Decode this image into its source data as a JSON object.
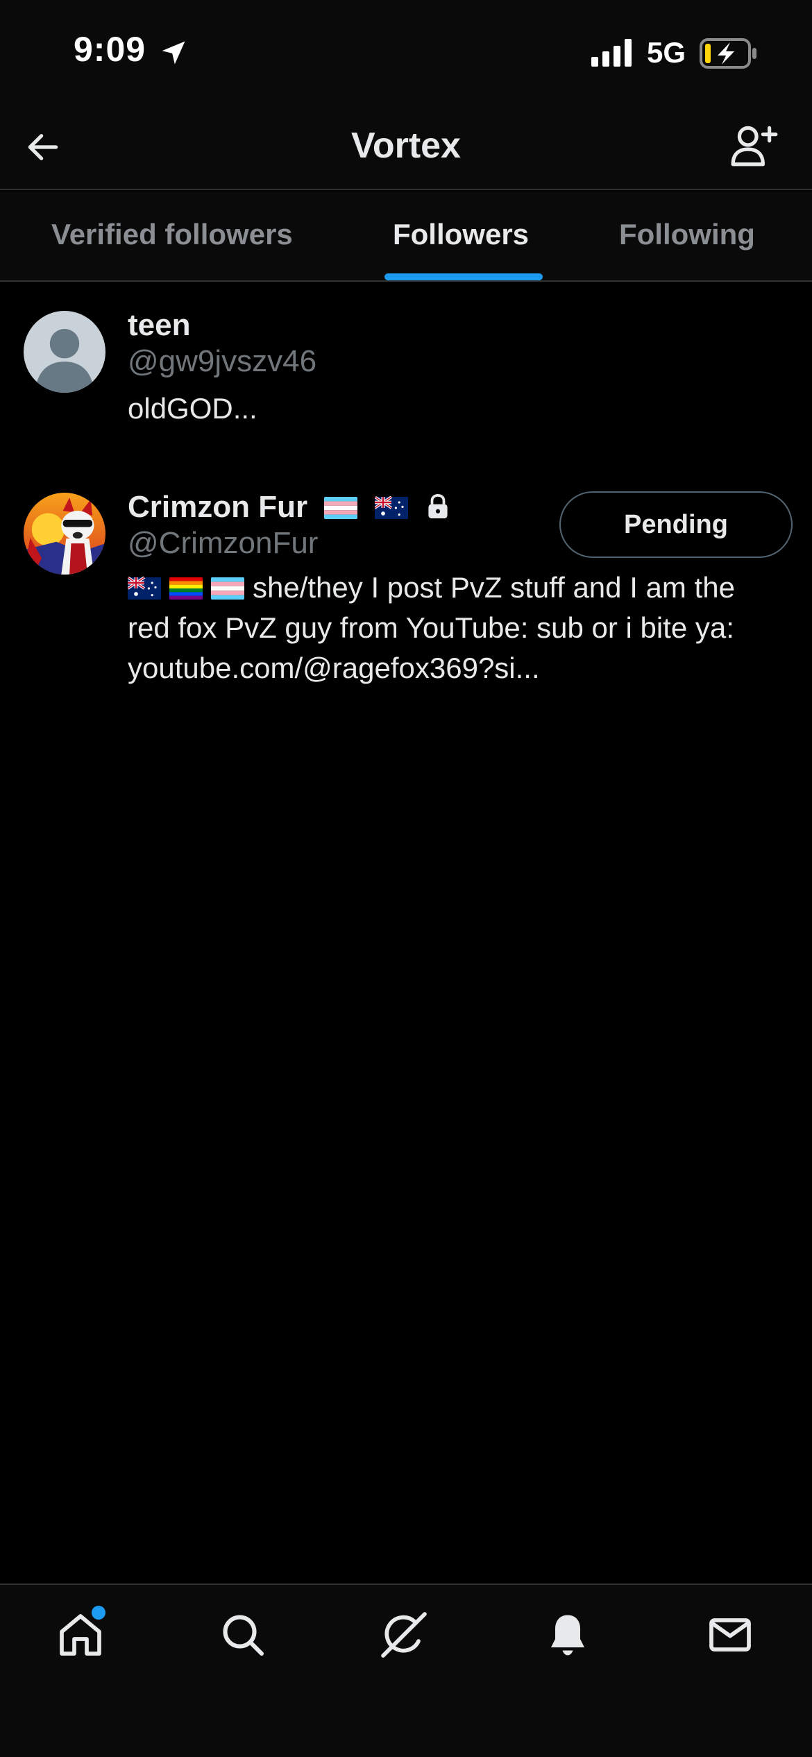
{
  "status_bar": {
    "time": "9:09",
    "network": "5G",
    "icons": [
      "location-arrow-icon",
      "signal-bars-icon",
      "battery-charging-icon"
    ]
  },
  "header": {
    "title": "Vortex",
    "back_icon": "arrow-left-icon",
    "action_icon": "add-user-icon"
  },
  "tabs": [
    {
      "label": "Verified followers",
      "active": false
    },
    {
      "label": "Followers",
      "active": true
    },
    {
      "label": "Following",
      "active": false
    }
  ],
  "followers": [
    {
      "display_name": "teen",
      "handle": "@gw9jvszv46",
      "bio": "oldGOD...",
      "avatar": "default-avatar"
    },
    {
      "display_name": "Crimzon Fur",
      "name_badges": [
        "transgender-flag",
        "australia-flag",
        "lock-icon"
      ],
      "handle": "@CrimzonFur",
      "bio_flags": [
        "australia-flag",
        "rainbow-flag",
        "transgender-flag"
      ],
      "bio": "she/they I post PvZ stuff and I am the red fox PvZ guy from YouTube: sub or i bite ya: youtube.com/@ragefox369?si...",
      "avatar": "fox-avatar",
      "button_label": "Pending"
    }
  ],
  "bottom_nav": {
    "items": [
      "home-icon",
      "search-icon",
      "grok-icon",
      "bell-icon",
      "mail-icon"
    ],
    "notification_dot_on": "home-icon"
  },
  "colors": {
    "background": "#000000",
    "accent": "#1d9bf0",
    "text_primary": "#e7e9ea",
    "text_secondary": "#71767b",
    "divider": "#2f3336"
  }
}
